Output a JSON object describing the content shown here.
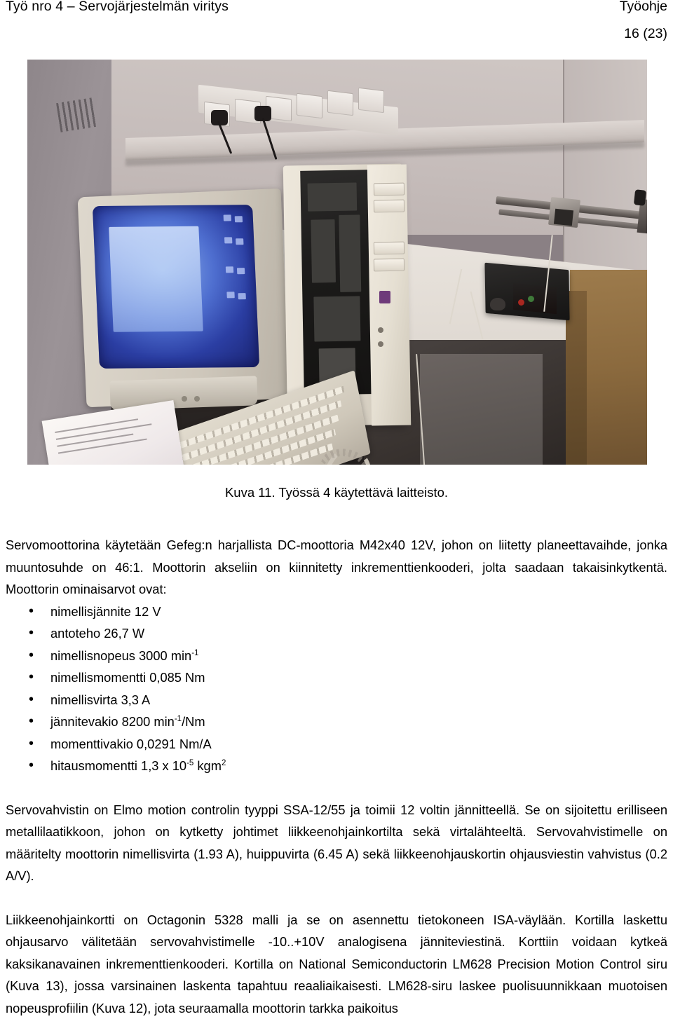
{
  "header": {
    "left_title": "Työ nro 4 – Servojärjestelmän viritys",
    "right_title": "Työohje",
    "page_number": "16 (23)"
  },
  "figure": {
    "caption": "Kuva 11. Työssä 4 käytettävä laitteisto.",
    "alt_description": "Valokuva laboratoriopöydästä: CRT-näyttö, avattu PC-tornikotelo, näppäimistö, musta virtalähde ja lineaarijohde."
  },
  "content": {
    "intro_paragraph": "Servomoottorina käytetään Gefeg:n harjallista DC-moottoria M42x40 12V, johon on liitetty planeettavaihde, jonka muuntosuhde on 46:1. Moottorin akseliin on kiinnitetty inkrementtienkooderi, jolta saadaan takaisinkytkentä. Moottorin ominaisarvot ovat:",
    "specs": [
      {
        "label": "nimellisjännite 12 V",
        "sup": ""
      },
      {
        "label": "antoteho 26,7 W",
        "sup": ""
      },
      {
        "label_pre": "nimellisnopeus 3000 min",
        "sup": "-1",
        "label_post": ""
      },
      {
        "label": "nimellismomentti 0,085 Nm",
        "sup": ""
      },
      {
        "label": "nimellisvirta 3,3 A",
        "sup": ""
      },
      {
        "label_pre": "jännitevakio 8200 min",
        "sup": "-1",
        "label_post": "/Nm"
      },
      {
        "label": "momenttivakio 0,0291 Nm/A",
        "sup": ""
      },
      {
        "label_pre": "hitausmomentti 1,3 x 10",
        "sup": "-5",
        "label_post": " kgm",
        "sup2": "2"
      }
    ],
    "spec_items": {
      "s0_text": "nimellisjännite 12 V",
      "s1_text": "antoteho 26,7 W",
      "s2_pre": "nimellisnopeus 3000 min",
      "s2_sup": "-1",
      "s3_text": "nimellismomentti 0,085 Nm",
      "s4_text": "nimellisvirta 3,3 A",
      "s5_pre": "jännitevakio 8200 min",
      "s5_sup": "-1",
      "s5_post": "/Nm",
      "s6_text": "momenttivakio 0,0291 Nm/A",
      "s7_pre": "hitausmomentti 1,3 x 10",
      "s7_sup": "-5",
      "s7_mid": " kgm",
      "s7_sup2": "2"
    },
    "amplifier_paragraph": "Servovahvistin on Elmo motion controlin tyyppi SSA-12/55 ja toimii 12 voltin jännitteellä. Se on sijoitettu erilliseen metallilaatikkoon, johon on kytketty johtimet liikkeenohjainkortilta sekä virtalähteeltä. Servovahvistimelle on määritelty moottorin nimellisvirta (1.93 A), huippuvirta (6.45 A) sekä liikkeenohjauskortin ohjausviestin vahvistus (0.2 A/V).",
    "controller_paragraph": "Liikkeenohjainkortti on Octagonin 5328 malli ja se on asennettu tietokoneen ISA-väylään. Kortilla laskettu ohjausarvo välitetään servovahvistimelle -10..+10V analogisena jänniteviestinä. Korttiin voidaan kytkeä kaksikanavainen inkrementtienkooderi. Kortilla on National Semiconductorin LM628 Precision Motion Control siru (Kuva 13), jossa varsinainen laskenta tapahtuu reaaliaikaisesti. LM628-siru laskee puolisuunnikkaan muotoisen nopeusprofiilin (Kuva 12), jota seuraamalla moottorin tarkka paikoitus"
  }
}
